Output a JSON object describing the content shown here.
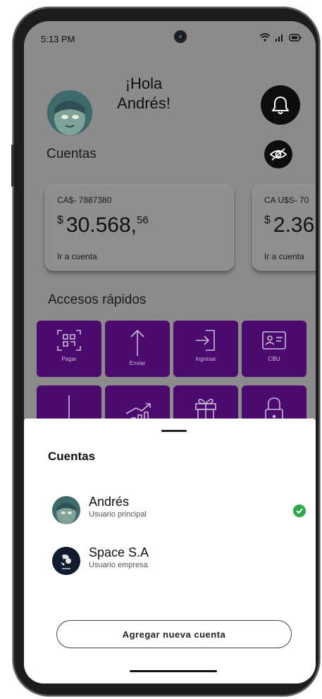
{
  "status_bar": {
    "time": "5:13 PM"
  },
  "header": {
    "greeting": "¡Hola Andrés!"
  },
  "accounts_section": {
    "title": "Cuentas",
    "cards": [
      {
        "id": "CA$- 7887380",
        "currency": "$",
        "amount": "30.568,",
        "cents": "56",
        "link": "Ir a cuenta"
      },
      {
        "id": "CA U$S- 70",
        "currency": "$",
        "amount": "2.36",
        "cents": "",
        "link": "Ir a cuenta"
      }
    ]
  },
  "quick_access": {
    "title": "Accesos rápidos",
    "items": [
      {
        "label": "Pagar",
        "icon": "qr-scan-icon"
      },
      {
        "label": "Enviar",
        "icon": "arrow-up-icon"
      },
      {
        "label": "Ingresar",
        "icon": "login-icon"
      },
      {
        "label": "CBU",
        "icon": "id-card-icon"
      },
      {
        "label": "",
        "icon": "arrow-down-icon"
      },
      {
        "label": "",
        "icon": "chart-growth-icon"
      },
      {
        "label": "",
        "icon": "gift-icon"
      },
      {
        "label": "",
        "icon": "lock-icon"
      }
    ]
  },
  "sheet": {
    "title": "Cuentas",
    "accounts": [
      {
        "name": "Andrés",
        "subtitle": "Usuario principal",
        "selected": true
      },
      {
        "name": "Space S.A",
        "subtitle": "Usuario empresa",
        "selected": false
      }
    ],
    "add_button": "Agregar nueva cuenta"
  },
  "colors": {
    "quick_access_bg": "#4b0a6e",
    "check_green": "#2ea84b",
    "overlay_gray": "#8b8b8b"
  }
}
